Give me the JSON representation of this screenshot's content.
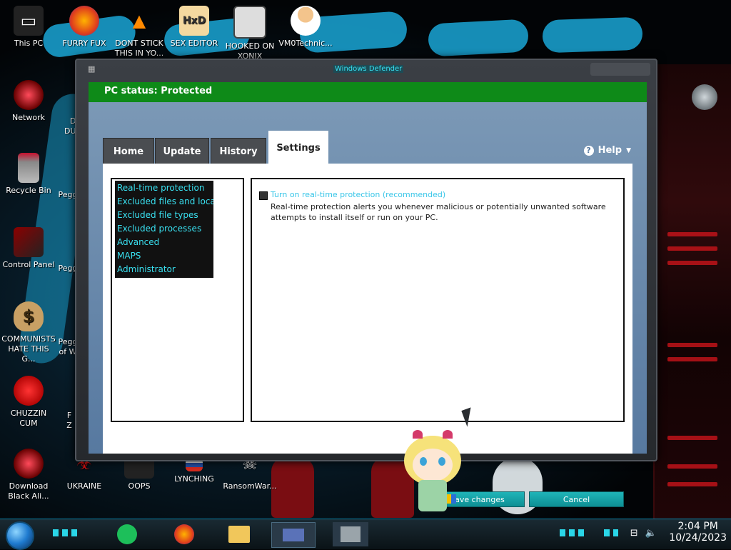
{
  "desktop": {
    "icons": [
      {
        "label": "This PC",
        "icon": "computer-icon"
      },
      {
        "label": "FURRY FUX",
        "icon": "firefox-icon"
      },
      {
        "label": "DONT STICK THIS IN YO...",
        "icon": "vlc-icon"
      },
      {
        "label": "SEX EDITOR",
        "icon": "hxd-icon"
      },
      {
        "label": "HOOKED ON XONIX",
        "icon": "game-icon"
      },
      {
        "label": "VM0Technic...",
        "icon": "doctor-icon"
      },
      {
        "label": "Network",
        "icon": "network-icon"
      },
      {
        "label": "Recycle Bin",
        "icon": "recycle-bin-icon"
      },
      {
        "label": "Control Panel",
        "icon": "control-panel-icon"
      },
      {
        "label": "COMMUNISTS HATE THIS G...",
        "icon": "money-bag-icon"
      },
      {
        "label": "CHUZZIN CUM",
        "icon": "chuzzle-icon"
      },
      {
        "label": "Download Black Ali...",
        "icon": "alienware-icon"
      },
      {
        "label": "UKRAINE",
        "icon": "biohazard-icon"
      },
      {
        "label": "OOPS",
        "icon": "hat-icon"
      },
      {
        "label": "LYNCHING",
        "icon": "flag-icon"
      },
      {
        "label": "RansomWar...",
        "icon": "skull-icon"
      }
    ],
    "partial_labels": [
      "D",
      "DU",
      "Pegg",
      "Pegg",
      "Pegg",
      "of W",
      "F",
      "Z"
    ]
  },
  "window": {
    "title": "Windows Defender",
    "status": "PC status: Protected",
    "tabs": [
      {
        "label": "Home",
        "active": false
      },
      {
        "label": "Update",
        "active": false
      },
      {
        "label": "History",
        "active": false
      },
      {
        "label": "Settings",
        "active": true
      }
    ],
    "help_label": "Help",
    "settings_list": [
      "Real-time protection",
      "Excluded files and locat...",
      "Excluded file types",
      "Excluded processes",
      "Advanced",
      "MAPS",
      "Administrator"
    ],
    "realtime": {
      "checkbox_label": "Turn on real-time protection (recommended)",
      "checked": false,
      "description": "Real-time protection alerts you whenever malicious or potentially unwanted software attempts to install itself or run on your PC."
    },
    "buttons": {
      "save": "Save changes",
      "cancel": "Cancel"
    }
  },
  "taskbar": {
    "time": "2:04 PM",
    "date": "10/24/2023",
    "apps": [
      "green-chat-icon",
      "firefox-icon",
      "file-explorer-icon",
      "window-app-icon",
      "wall-app-icon"
    ]
  },
  "colors": {
    "status_green": "#0e8a18",
    "accent_cyan": "#39e0f0",
    "button_teal": "#1fb4b8",
    "defender_blue": "#5779a0"
  }
}
